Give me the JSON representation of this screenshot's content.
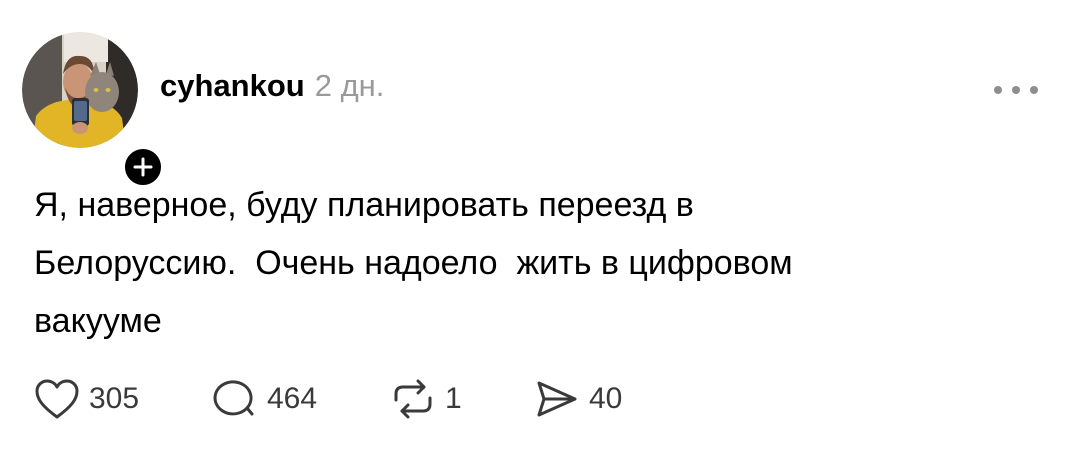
{
  "post": {
    "author": {
      "username": "cyhankou",
      "avatar_icon": "avatar-photo",
      "follow_icon": "plus-icon"
    },
    "time_ago": "2 дн.",
    "more_icon": "ellipsis-icon",
    "text": "Я, наверное, буду планировать переезд в\nБелоруссию.  Очень надоело  жить в цифровом\nвакууме",
    "actions": {
      "likes": {
        "icon": "heart-icon",
        "count": "305"
      },
      "replies": {
        "icon": "comment-icon",
        "count": "464"
      },
      "reposts": {
        "icon": "repost-icon",
        "count": "1"
      },
      "shares": {
        "icon": "send-icon",
        "count": "40"
      }
    }
  },
  "colors": {
    "text": "#000000",
    "secondary": "#9a9a9a",
    "icon": "#3a3a3a"
  }
}
